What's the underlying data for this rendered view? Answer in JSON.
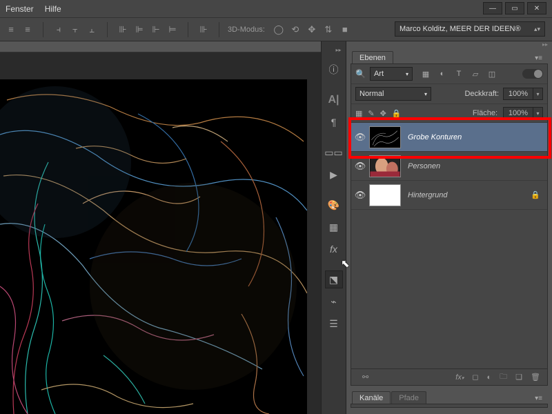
{
  "menu": {
    "fenster": "Fenster",
    "hilfe": "Hilfe"
  },
  "optbar": {
    "mode_label": "3D-Modus:"
  },
  "workspace": {
    "name": "Marco Kolditz, MEER DER IDEEN®"
  },
  "layers_panel": {
    "tab": "Ebenen",
    "filter_dd": "Art",
    "blend_dd": "Normal",
    "opacity_label": "Deckkraft:",
    "opacity_value": "100%",
    "fill_label": "Fläche:",
    "fill_value": "100%",
    "layers": [
      {
        "name": "Grobe Konturen",
        "selected": true,
        "visible": true,
        "thumb": "noise",
        "locked": false
      },
      {
        "name": "Personen",
        "selected": false,
        "visible": true,
        "thumb": "photo",
        "locked": false
      },
      {
        "name": "Hintergrund",
        "selected": false,
        "visible": true,
        "thumb": "white",
        "locked": true
      }
    ]
  },
  "channels_panel": {
    "tab1": "Kanäle",
    "tab2": "Pfade"
  }
}
